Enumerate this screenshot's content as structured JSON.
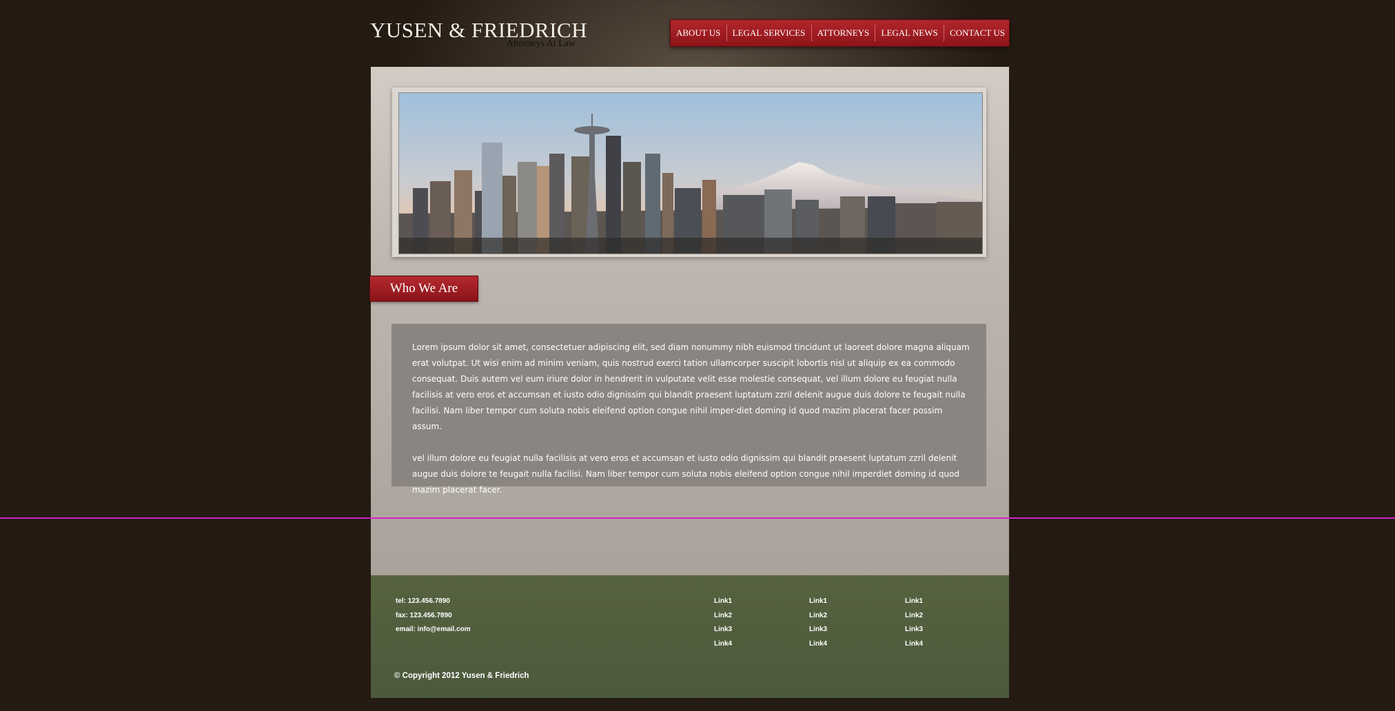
{
  "header": {
    "title": "YUSEN & FRIEDRICH",
    "subtitle": "Attorneys At Law"
  },
  "nav": {
    "items": [
      "ABOUT US",
      "LEGAL SERVICES",
      "ATTORNEYS",
      "LEGAL NEWS",
      "CONTACT US"
    ]
  },
  "section": {
    "heading": "Who We Are",
    "paragraphs": [
      "Lorem ipsum dolor sit amet, consectetuer adipiscing elit, sed diam nonummy nibh euismod tincidunt ut laoreet dolore magna aliquam erat volutpat. Ut wisi enim ad minim veniam, quis nostrud exerci tation ullamcorper suscipit lobortis nisl ut aliquip ex ea commodo consequat. Duis autem vel eum iriure dolor in hendrerit in vulputate velit esse molestie consequat, vel illum dolore eu feugiat nulla facilisis at vero eros et accumsan et iusto odio dignissim qui blandit praesent luptatum zzril delenit augue duis dolore te feugait nulla facilisi. Nam liber tempor cum soluta nobis eleifend option congue nihil imper-diet doming id quod mazim placerat facer possim assum.",
      "vel illum dolore eu feugiat nulla facilisis at vero eros et accumsan et iusto odio dignissim qui blandit praesent luptatum zzril delenit augue duis dolore te feugait nulla facilisi. Nam liber tempor cum soluta nobis eleifend option congue nihil imperdiet doming id quod mazim placerat facer."
    ]
  },
  "footer": {
    "tel": "tel: 123.456.7890",
    "fax": "fax: 123.456.7890",
    "email": "email: info@email.com",
    "link_columns": [
      [
        "Link1",
        "Link2",
        "Link3",
        "Link4"
      ],
      [
        "Link1",
        "Link2",
        "Link3",
        "Link4"
      ],
      [
        "Link1",
        "Link2",
        "Link3",
        "Link4"
      ]
    ],
    "copyright": "© Copyright 2012 Yusen & Friedrich"
  },
  "colors": {
    "background": "#231910",
    "nav_red": "#a01e24",
    "footer_green": "#52603f",
    "content_box": "#8a8580",
    "divider": "#d421c8"
  }
}
